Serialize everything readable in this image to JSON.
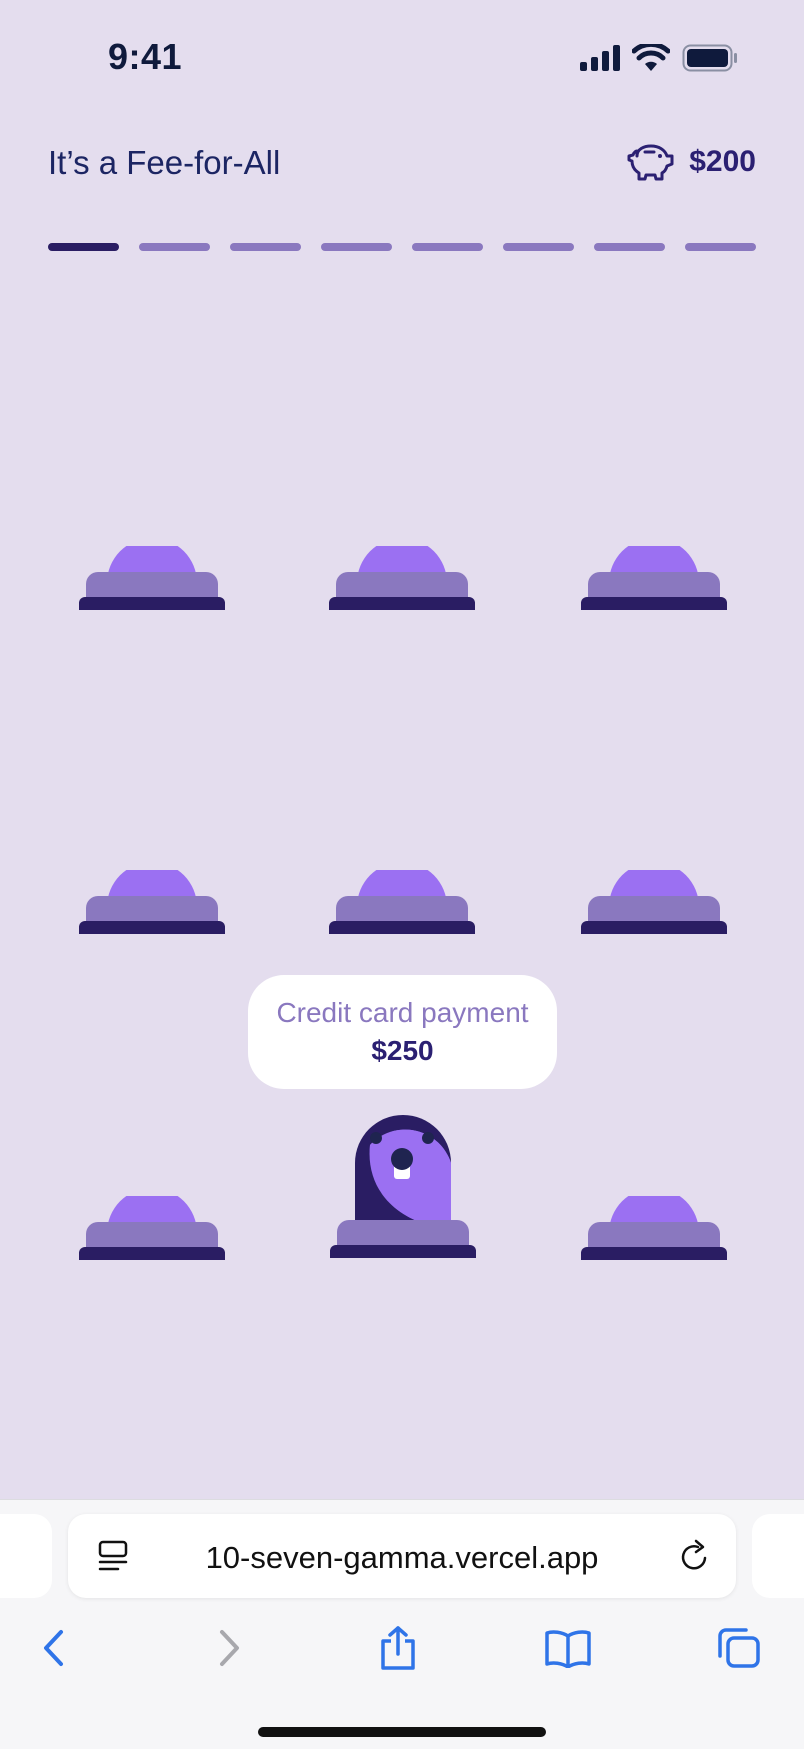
{
  "status": {
    "time": "9:41"
  },
  "header": {
    "title": "It’s a Fee-for-All",
    "coins": "$200"
  },
  "progress": {
    "total": 8,
    "current": 1
  },
  "tooltip": {
    "label": "Credit card payment",
    "amount": "$250"
  },
  "browser": {
    "url": "10-seven-gamma.vercel.app"
  },
  "colors": {
    "background": "#e4ddee",
    "dome": "#9b70f2",
    "rim": "#8a78bf",
    "base": "#2a1d63",
    "text_dark": "#1c2563",
    "accent_link": "#2f74e8"
  }
}
